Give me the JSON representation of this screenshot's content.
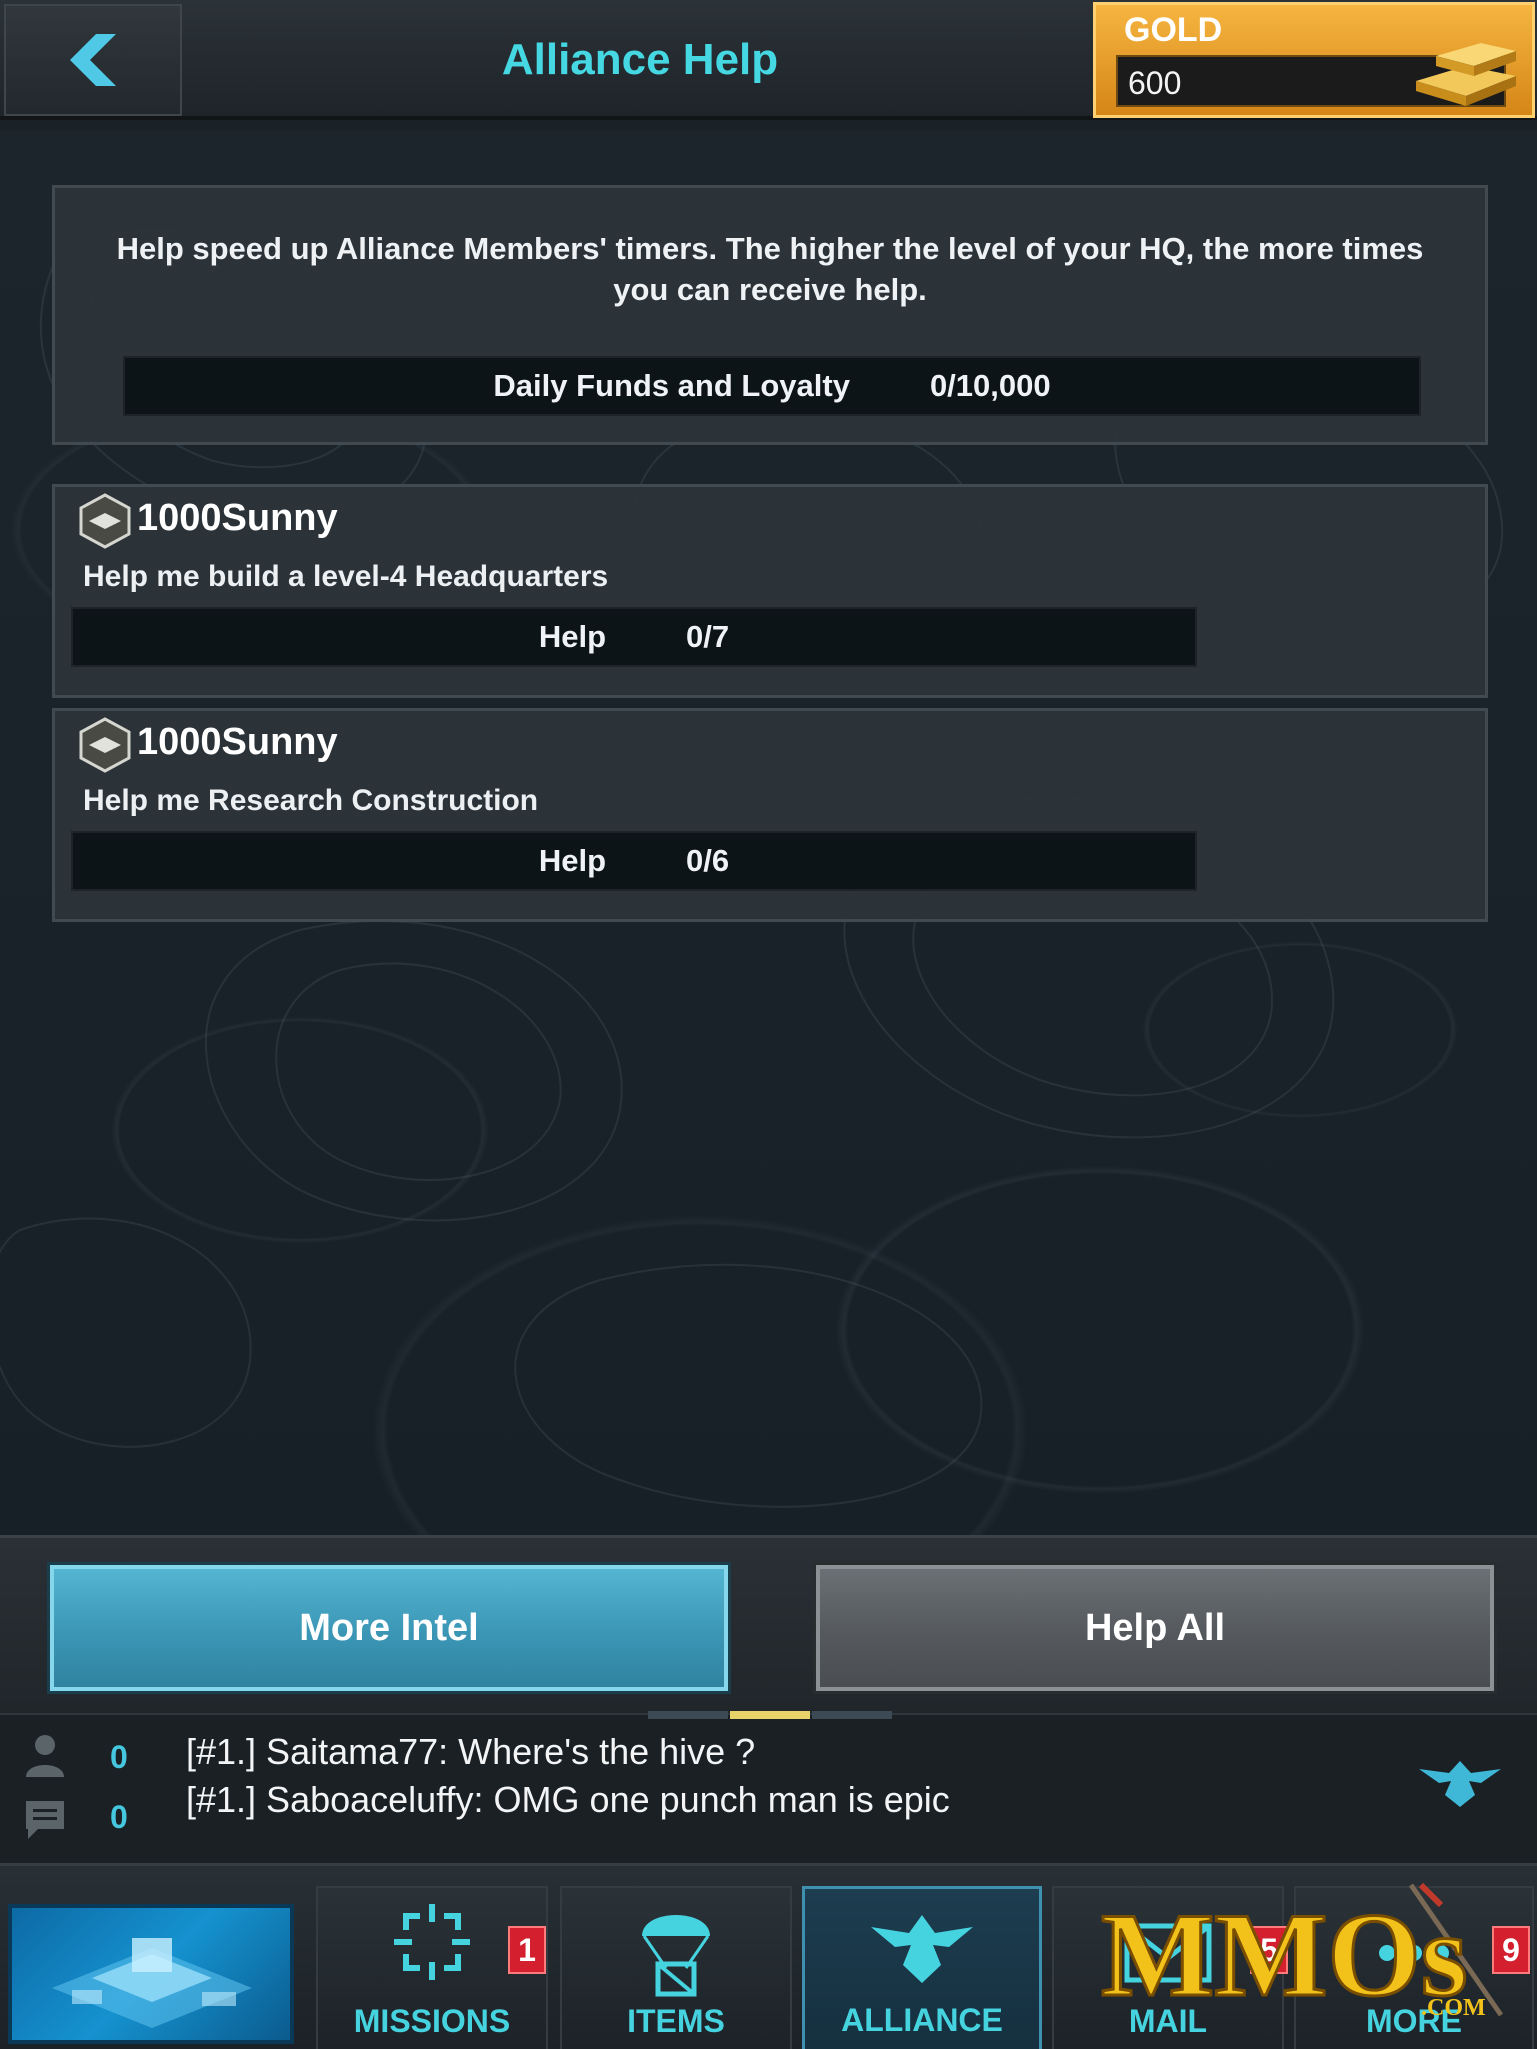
{
  "header": {
    "title": "Alliance Help",
    "gold_label": "GOLD",
    "gold_value": "600"
  },
  "intro": {
    "text": "Help speed up Alliance Members' timers. The higher the level of your HQ, the more times you can receive help.",
    "progress_label": "Daily Funds and Loyalty",
    "progress_value": "0/10,000"
  },
  "requests": [
    {
      "player": "1000Sunny",
      "description": "Help me build a level-4 Headquarters",
      "help_label": "Help",
      "help_count": "0/7"
    },
    {
      "player": "1000Sunny",
      "description": "Help me Research Construction",
      "help_label": "Help",
      "help_count": "0/6"
    }
  ],
  "actions": {
    "more_intel": "More Intel",
    "help_all": "Help All"
  },
  "chat": {
    "player_count": "0",
    "message_count": "0",
    "messages": [
      "[#1.] Saitama77:  Where's the hive ?",
      "[#1.] Saboaceluffy: OMG one punch man is epic"
    ]
  },
  "nav": {
    "items": [
      {
        "label": "MISSIONS",
        "badge": "1",
        "icon": "crosshair-icon"
      },
      {
        "label": "ITEMS",
        "badge": "",
        "icon": "parachute-crate-icon"
      },
      {
        "label": "ALLIANCE",
        "badge": "",
        "icon": "eagle-icon"
      },
      {
        "label": "MAIL",
        "badge": "5",
        "icon": "mail-icon"
      },
      {
        "label": "MORE",
        "badge": "9",
        "icon": "more-icon"
      }
    ]
  },
  "watermark": {
    "text": "MMOs",
    "suffix": ".COM"
  },
  "colors": {
    "accent_cyan": "#45d7e2",
    "gold": "#f6b540",
    "button_blue": "#3b96b5",
    "button_gray": "#55595d",
    "badge_red": "#d4202e"
  }
}
